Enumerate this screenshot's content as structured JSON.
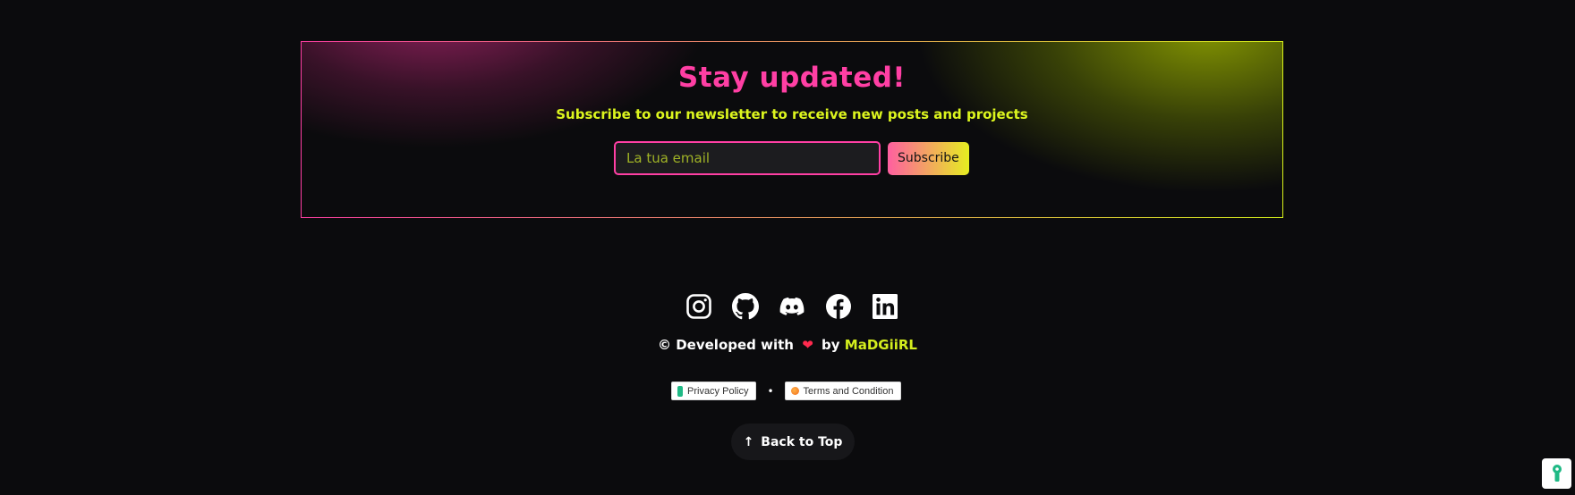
{
  "newsletter": {
    "title": "Stay updated!",
    "subtitle": "Subscribe to our newsletter to receive new posts and projects",
    "email_placeholder": "La tua email",
    "email_value": "",
    "subscribe_label": "Subscribe"
  },
  "social": [
    {
      "name": "instagram-icon"
    },
    {
      "name": "github-icon"
    },
    {
      "name": "discord-icon"
    },
    {
      "name": "facebook-icon"
    },
    {
      "name": "linkedin-icon"
    }
  ],
  "credit": {
    "prefix": "© Developed with",
    "heart": "❤",
    "by": "by",
    "author": "MaDGiiRL"
  },
  "policies": {
    "privacy_label": "Privacy Policy",
    "separator": "•",
    "terms_label": "Terms and Condition"
  },
  "back_to_top": {
    "arrow": "↑",
    "label": "Back to Top"
  },
  "colors": {
    "accent_pink": "#ff3fa4",
    "accent_lime": "#dcf51e",
    "background": "#0b0b0d"
  }
}
